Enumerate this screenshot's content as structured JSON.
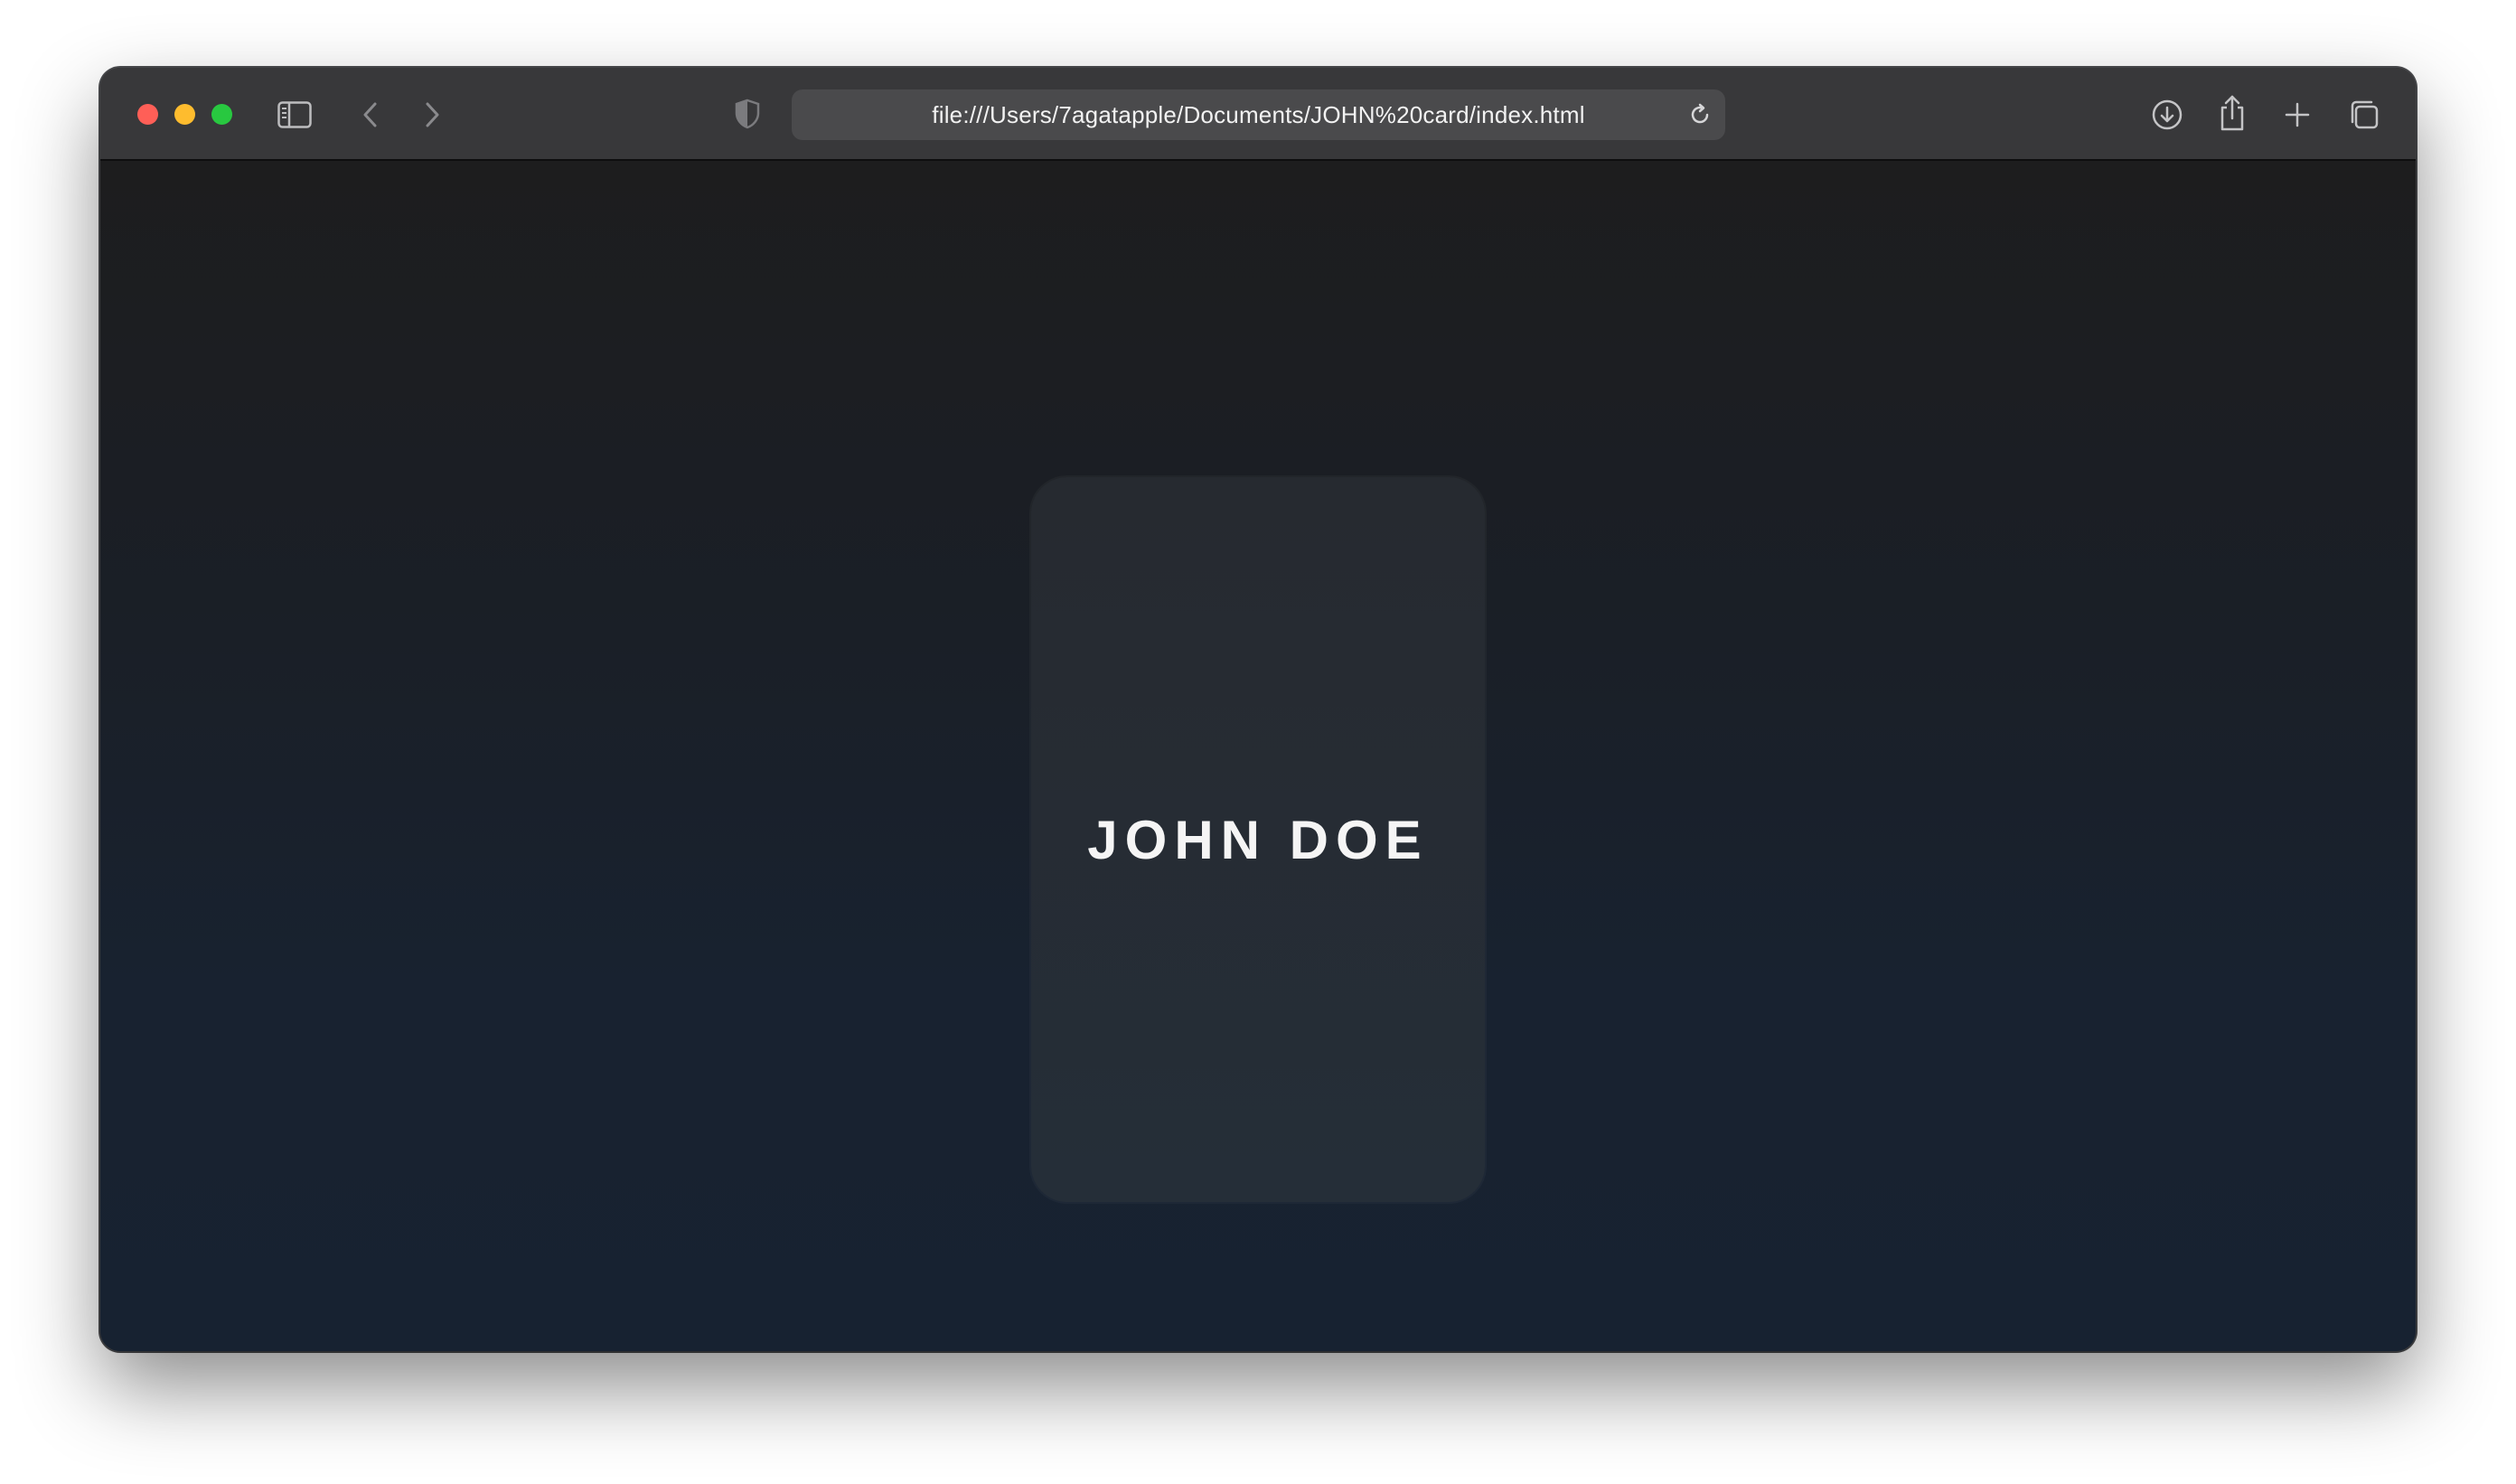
{
  "browser": {
    "url": "file:///Users/7agatapple/Documents/JOHN%20card/index.html",
    "traffic_lights": {
      "close_color": "#ff5f57",
      "minimize_color": "#febc2e",
      "zoom_color": "#28c840"
    },
    "toolbar_icons": [
      "sidebar-icon",
      "back-icon",
      "forward-icon",
      "privacy-shield-icon",
      "reload-icon",
      "download-icon",
      "share-icon",
      "new-tab-icon",
      "tab-overview-icon"
    ]
  },
  "page": {
    "card": {
      "name": "JOHN DOE"
    }
  }
}
